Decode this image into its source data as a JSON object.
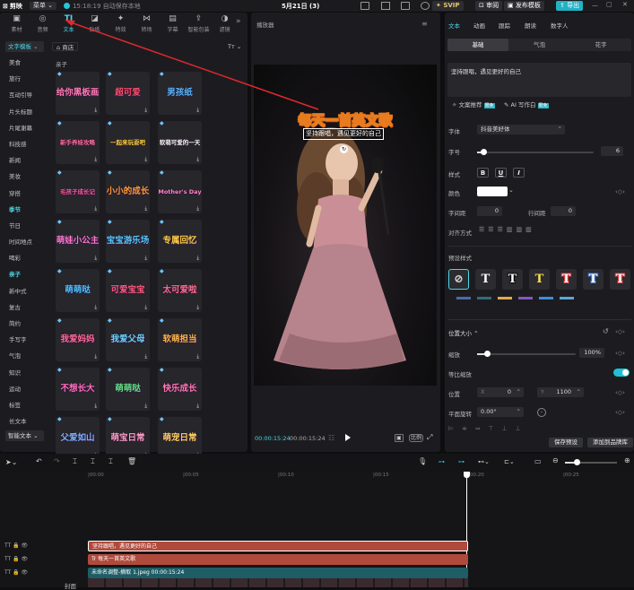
{
  "titlebar": {
    "app": "剪映",
    "menu": "菜单",
    "autosave": "15:18:19 自动保存本地",
    "date": "5月21日 (3)",
    "svip": "SVIP",
    "review": "审阅",
    "publish_template": "发布模板",
    "export": "导出"
  },
  "tooltabs": [
    {
      "label": "素材",
      "icon": "media-icon"
    },
    {
      "label": "音频",
      "icon": "audio-icon"
    },
    {
      "label": "文本",
      "icon": "text-icon"
    },
    {
      "label": "贴纸",
      "icon": "sticker-icon"
    },
    {
      "label": "特效",
      "icon": "effects-icon"
    },
    {
      "label": "转场",
      "icon": "transition-icon"
    },
    {
      "label": "字幕",
      "icon": "subtitle-icon"
    },
    {
      "label": "智能包装",
      "icon": "smart-pack-icon"
    },
    {
      "label": "滤镜",
      "icon": "filter-icon"
    }
  ],
  "categories": {
    "top": "文字模板 ⌄",
    "items": [
      "美食",
      "旅行",
      "互动引导",
      "片头标题",
      "片尾谢幕",
      "科技感",
      "新闻",
      "美妆",
      "穿搭",
      "季节",
      "节日",
      "时间地点",
      "喝彩",
      "亲子",
      "新中式",
      "复古",
      "简约",
      "手写字",
      "气泡",
      "知识",
      "运动",
      "标签",
      "长文本"
    ],
    "bottom": "智能文本 ⌄"
  },
  "store": {
    "label": "商店",
    "sort": "Tт ⌄"
  },
  "grid_title": "亲子",
  "tiles": [
    {
      "text": "给你黑板画",
      "color": "#ff7ab6"
    },
    {
      "text": "超可爱",
      "color": "#ff4d6d"
    },
    {
      "text": "男孩纸",
      "color": "#59b8ff"
    },
    {
      "text": "新手养娃攻略",
      "color": "#ff6ea0"
    },
    {
      "text": "一起来玩耍吧",
      "color": "#ffd23f"
    },
    {
      "text": "软萌可爱的一天",
      "color": "#ffffff"
    },
    {
      "text": "毛孩子成长记",
      "color": "#ff5fa2"
    },
    {
      "text": "小小的成长",
      "color": "#ff9d3c"
    },
    {
      "text": "Mother's Day",
      "color": "#ff86c8"
    },
    {
      "text": "萌娃小公主",
      "color": "#ff7ad1"
    },
    {
      "text": "宝宝游乐场",
      "color": "#5cc9ff"
    },
    {
      "text": "专属回忆",
      "color": "#ffcf4a"
    },
    {
      "text": "萌萌哒",
      "color": "#4fc3ff"
    },
    {
      "text": "可爱宝宝",
      "color": "#ff5b80"
    },
    {
      "text": "太可爱啦",
      "color": "#ff6f91"
    },
    {
      "text": "我爱妈妈",
      "color": "#ff6b9a"
    },
    {
      "text": "我爱父母",
      "color": "#6fd3ff"
    },
    {
      "text": "软萌担当",
      "color": "#ffb84d"
    },
    {
      "text": "不想长大",
      "color": "#ff70c0"
    },
    {
      "text": "萌萌哒",
      "color": "#66e08a"
    },
    {
      "text": "快乐成长",
      "color": "#ff7ab0"
    },
    {
      "text": "父爱如山",
      "color": "#7fb7ff"
    },
    {
      "text": "萌宝日常",
      "color": "#ff9ec7"
    },
    {
      "text": "萌宠日常",
      "color": "#ffd166"
    }
  ],
  "player": {
    "title": "播放器",
    "headline": "每天一首英文歌",
    "subtitle": "坚持跟唱，遇见更好的自己",
    "time_current": "00:00:15:24",
    "time_total": "00:00:15:24",
    "ratio_label": "比例"
  },
  "inspector": {
    "tabs": [
      "文本",
      "动画",
      "跟踪",
      "朗读",
      "数字人"
    ],
    "subtabs": [
      "基础",
      "气泡",
      "花字"
    ],
    "text_value": "坚持跟唱，遇见更好的自己",
    "rec_label": "文案推荐",
    "ai_label": "AI 写作白",
    "font_label": "字体",
    "font_value": "抖音美好体",
    "size_label": "字号",
    "size_value": "6",
    "size_level": 0.05,
    "style_label": "样式",
    "style_buttons": [
      "B",
      "U",
      "I"
    ],
    "color_label": "颜色",
    "color_value": "#ffffff",
    "letter_label": "字间距",
    "letter_value": "0",
    "line_label": "行间距",
    "line_value": "0",
    "align_label": "对齐方式",
    "preset_label": "预设样式",
    "presets": [
      {
        "glyph": "⊘",
        "fg": "#cccccc",
        "border": "#4cd6e5"
      },
      {
        "glyph": "T",
        "fg": "#ffffff"
      },
      {
        "glyph": "T",
        "fg": "#ffffff",
        "outline": "#000000"
      },
      {
        "glyph": "T",
        "fg": "#ffe14a"
      },
      {
        "glyph": "T",
        "fg": "#ffffff",
        "outline": "#e83e3e"
      },
      {
        "glyph": "T",
        "fg": "#ffffff",
        "outline": "#3e7ee8"
      },
      {
        "glyph": "T",
        "fg": "#ffffff",
        "outline": "#e83e3e"
      }
    ],
    "pos_size_label": "位置大小 ⌃",
    "scale_label": "缩放",
    "scale_value": "100%",
    "scale_level": 0.1,
    "uniform_label": "等比缩放",
    "position_label": "位置",
    "pos_x_label": "X",
    "pos_x": "0",
    "pos_y_label": "Y",
    "pos_y": "1100",
    "rotate_label": "平面旋转",
    "rotate_value": "0.00°",
    "save_preset": "保存预设",
    "add_to_library": "添加到品牌库"
  },
  "timeline": {
    "ruler": [
      "|00:00",
      "|00:05",
      "|00:10",
      "|00:15",
      "|00:20",
      "|00:25"
    ],
    "tracks": [
      {
        "label": "坚持跟唱，遇见更好的自己",
        "color": "#b04a3c"
      },
      {
        "label": "Tr  每天一首英文歌",
        "color": "#b04a3c"
      },
      {
        "label": "未命名调整-摘取 1.jpeg  00:00:15:24",
        "color": "#1f5d66"
      }
    ],
    "cover_label": "封面"
  }
}
